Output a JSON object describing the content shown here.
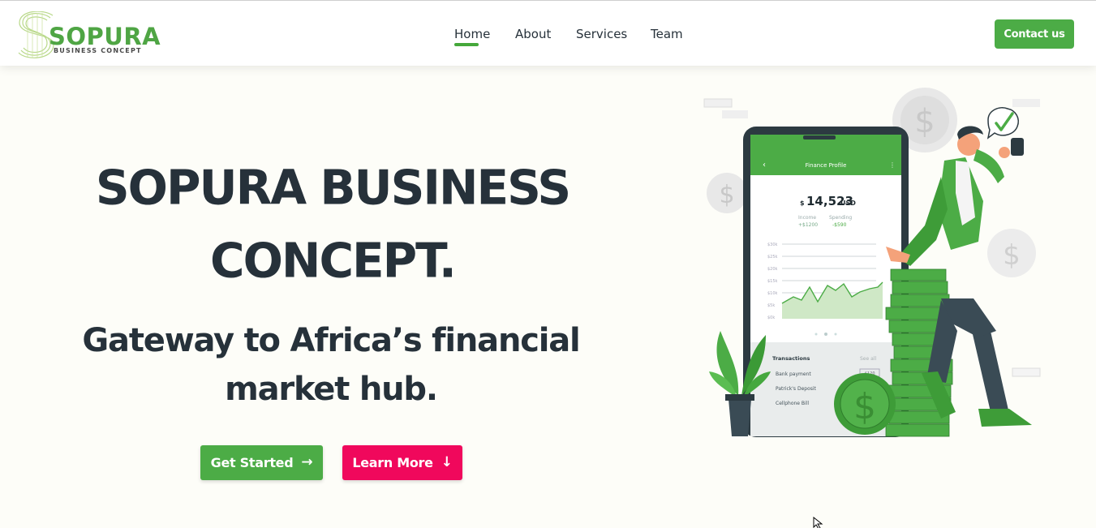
{
  "logo": {
    "wordmark": "SOPURA",
    "tagline": "BUSINESS CONCEPT"
  },
  "nav": {
    "items": [
      {
        "label": "Home",
        "active": true
      },
      {
        "label": "About",
        "active": false
      },
      {
        "label": "Services",
        "active": false
      },
      {
        "label": "Team",
        "active": false
      }
    ],
    "contact_label": "Contact us"
  },
  "hero": {
    "title_line1": "SOPURA BUSINESS",
    "title_line2": "CONCEPT.",
    "subtitle_line1": "Gateway to Africa’s financial",
    "subtitle_line2": "market hub.",
    "get_started_label": "Get Started",
    "learn_more_label": "Learn More"
  },
  "phone": {
    "screen_title": "Finance Profile",
    "currency_symbol": "$",
    "balance": "14,523",
    "currency": "USD",
    "income_label": "Income",
    "income_value": "+$1200",
    "spending_label": "Spending",
    "spending_value": "-$590",
    "y_ticks": [
      "$30k",
      "$25k",
      "$20k",
      "$15k",
      "$10k",
      "$5k",
      "$0k"
    ],
    "transactions_title": "Transactions",
    "see_all_label": "See all",
    "transactions": [
      {
        "name": "Bank payment",
        "amount": "-$120"
      },
      {
        "name": "Patrick's Deposit",
        "amount": ""
      },
      {
        "name": "Cellphone Bill",
        "amount": ""
      }
    ]
  },
  "colors": {
    "brand_green": "#4cac46",
    "accent_pink": "#f0085c",
    "text_dark": "#26313a",
    "page_bg": "#fdfdf8"
  }
}
